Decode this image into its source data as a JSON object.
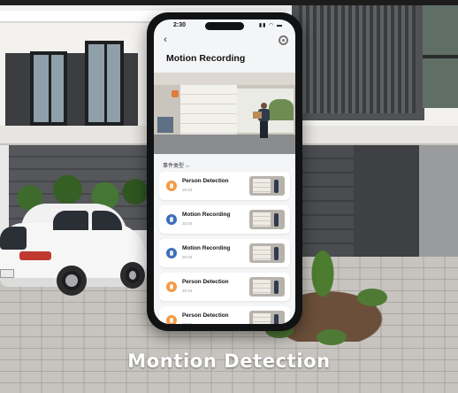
{
  "phone": {
    "status_time": "2:30",
    "status_icons": "▮▮ ◠ ▬",
    "page_title": "Motion Recording",
    "filter_label": "事件类型",
    "events": [
      {
        "type": "person",
        "title": "Person Detection",
        "time": "20:04"
      },
      {
        "type": "motion",
        "title": "Motion Recording",
        "time": "20:04"
      },
      {
        "type": "motion",
        "title": "Motion Recording",
        "time": "20:04"
      },
      {
        "type": "person",
        "title": "Person Detection",
        "time": "20:04"
      },
      {
        "type": "person",
        "title": "Person Detection",
        "time": "20:04"
      }
    ]
  },
  "caption": "Montion Detection",
  "colors": {
    "person_icon": "#f29a44",
    "motion_icon": "#3d6fb8",
    "caption_text": "#ffffff"
  },
  "icons": {
    "back": "back-arrow-icon",
    "settings": "gear-icon",
    "filter": "chevron-down-icon"
  }
}
